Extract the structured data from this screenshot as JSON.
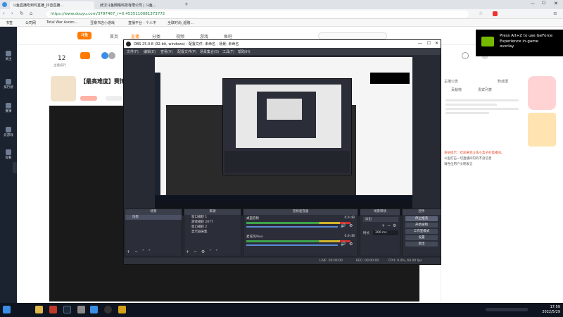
{
  "browser": {
    "tabs": [
      {
        "label": "斗鱼直播吃到鸡直播_抖音直播...",
        "active": true
      },
      {
        "label": "武汉斗鱼网络科技有限公司 | 斗鱼...",
        "active": false
      }
    ],
    "url": "https://www.douyu.com/3797467_r=0.4535110081373772",
    "bookmarks": [
      "书签",
      "公司网",
      "Total War Ascen...",
      "豆瓣书店小游戏",
      "直播平台 - 个人中",
      "全联时尚_超赌..."
    ]
  },
  "douyu": {
    "logo": "斗鱼",
    "nav": [
      "首页",
      "直播",
      "分类",
      "视频",
      "游戏",
      "鱼吧"
    ],
    "sidebar": [
      "关注",
      "排行榜",
      "赛事",
      "云游戏",
      "观看"
    ],
    "room": {
      "count_label": "12",
      "count_sub": "主播排行",
      "title": "【最高难度】赛博...",
      "tabs": [
        "主播公告",
        "贡献榜",
        "贵宾列表",
        "粉丝团"
      ],
      "chat_lines": [
        "系统提示：欢迎来到斗鱼小盒子的直播间。",
        "斗鱼打击一切直播间内的不良信息",
        "请各位用户文明发言"
      ]
    }
  },
  "obs": {
    "title": "OBS 25.0.8 (32-bit, windows) - 配置文件: 未命名 - 场景: 未命名",
    "menu": [
      "文件(F)",
      "编辑(E)",
      "查看(V)",
      "配置文件(P)",
      "场景集合(S)",
      "工具(T)",
      "帮助(H)"
    ],
    "docks": {
      "scenes": {
        "title": "场景",
        "items": [
          "场景"
        ]
      },
      "sources": {
        "title": "来源",
        "items": [
          "窗口捕获 1",
          "游戏捕获 2077",
          "窗口捕获 2",
          "显示器采集"
        ]
      },
      "mixer": {
        "title": "音频混音器",
        "channels": [
          {
            "name": "桌面音频",
            "db": "0.0 dB"
          },
          {
            "name": "麦克风/Aux",
            "db": "0.0 dB"
          }
        ]
      },
      "transitions": {
        "title": "场景转场",
        "type": "淡出",
        "duration_label": "时长",
        "duration": "300 ms"
      },
      "controls": {
        "title": "控件",
        "buttons": [
          "停止推流",
          "开始录制",
          "工作室模式",
          "设置",
          "退出"
        ]
      }
    },
    "status": {
      "live": "LIVE: 00:00:00",
      "rec": "REC: 00:00:00",
      "cpu": "CPU: 0.4%, 60.00 fps"
    }
  },
  "nvidia": {
    "lines": [
      "Press Alt+Z to use GeForce",
      "Experience in-game",
      "overlay"
    ]
  },
  "taskbar": {
    "time": "17:59",
    "date": "2022/5/29"
  },
  "colors": {
    "douyu_orange": "#ff7a00",
    "obs_bg": "#272a33",
    "nvidia_green": "#76b900",
    "taskbar": "#0f1520"
  }
}
